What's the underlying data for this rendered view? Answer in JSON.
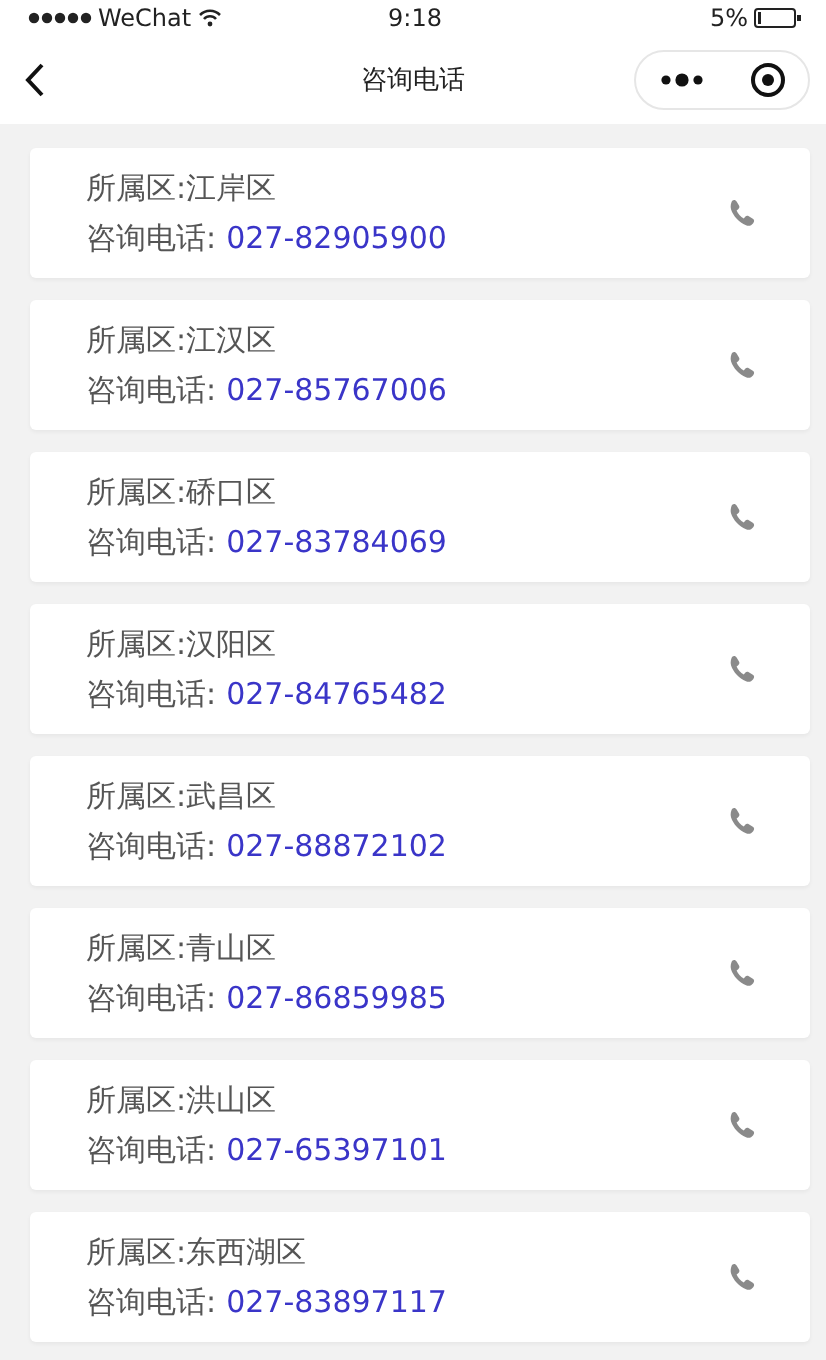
{
  "status_bar": {
    "carrier": "WeChat",
    "time": "9:18",
    "battery": "5%"
  },
  "nav_bar": {
    "title": "咨询电话"
  },
  "contacts": [
    {
      "district": "所属区:江岸区",
      "phone_label": "咨询电话:",
      "phone": "027-82905900"
    },
    {
      "district": "所属区:江汉区",
      "phone_label": "咨询电话:",
      "phone": "027-85767006"
    },
    {
      "district": "所属区:硚口区",
      "phone_label": "咨询电话:",
      "phone": "027-83784069"
    },
    {
      "district": "所属区:汉阳区",
      "phone_label": "咨询电话:",
      "phone": "027-84765482"
    },
    {
      "district": "所属区:武昌区",
      "phone_label": "咨询电话:",
      "phone": "027-88872102"
    },
    {
      "district": "所属区:青山区",
      "phone_label": "咨询电话:",
      "phone": "027-86859985"
    },
    {
      "district": "所属区:洪山区",
      "phone_label": "咨询电话:",
      "phone": "027-65397101"
    },
    {
      "district": "所属区:东西湖区",
      "phone_label": "咨询电话:",
      "phone": "027-83897117"
    }
  ]
}
